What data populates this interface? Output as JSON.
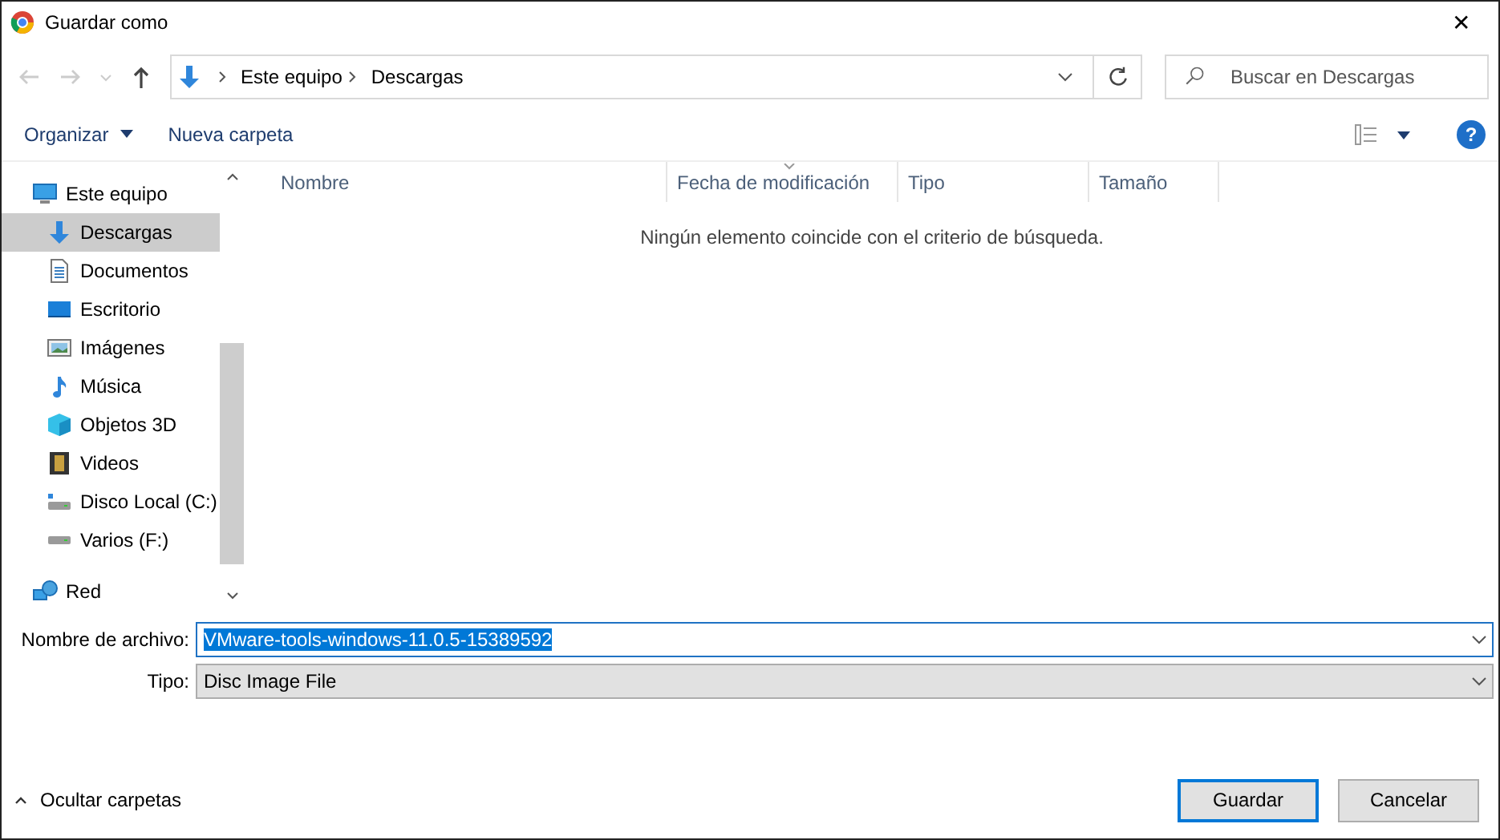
{
  "window": {
    "title": "Guardar como",
    "close_label": "✕"
  },
  "nav": {
    "back_disabled": true,
    "forward_disabled": true,
    "up_disabled": false
  },
  "address": {
    "breadcrumb": [
      "Este equipo",
      "Descargas"
    ]
  },
  "search": {
    "placeholder": "Buscar en Descargas"
  },
  "toolbar": {
    "organize": "Organizar",
    "new_folder": "Nueva carpeta",
    "help": "?"
  },
  "sidebar": {
    "items": [
      {
        "label": "Este equipo",
        "selected": false,
        "children": [
          {
            "label": "Descargas",
            "selected": true
          },
          {
            "label": "Documentos",
            "selected": false
          },
          {
            "label": "Escritorio",
            "selected": false
          },
          {
            "label": "Imágenes",
            "selected": false
          },
          {
            "label": "Música",
            "selected": false
          },
          {
            "label": "Objetos 3D",
            "selected": false
          },
          {
            "label": "Videos",
            "selected": false
          },
          {
            "label": "Disco Local (C:)",
            "selected": false
          },
          {
            "label": "Varios (F:)",
            "selected": false
          }
        ]
      },
      {
        "label": "Red",
        "selected": false
      }
    ]
  },
  "table": {
    "columns": [
      {
        "label": "Nombre",
        "sorted": false
      },
      {
        "label": "Fecha de modificación",
        "sorted": true
      },
      {
        "label": "Tipo",
        "sorted": false
      },
      {
        "label": "Tamaño",
        "sorted": false
      }
    ],
    "empty_message": "Ningún elemento coincide con el criterio de búsqueda."
  },
  "form": {
    "filename_label": "Nombre de archivo:",
    "filename": "VMware-tools-windows-11.0.5-15389592",
    "filename_selected": true,
    "type_label": "Tipo:",
    "type": "Disc Image File"
  },
  "footer": {
    "toggle": "Ocultar carpetas",
    "buttons": [
      {
        "label": "Guardar",
        "default": true
      },
      {
        "label": "Cancelar",
        "default": false
      }
    ]
  }
}
